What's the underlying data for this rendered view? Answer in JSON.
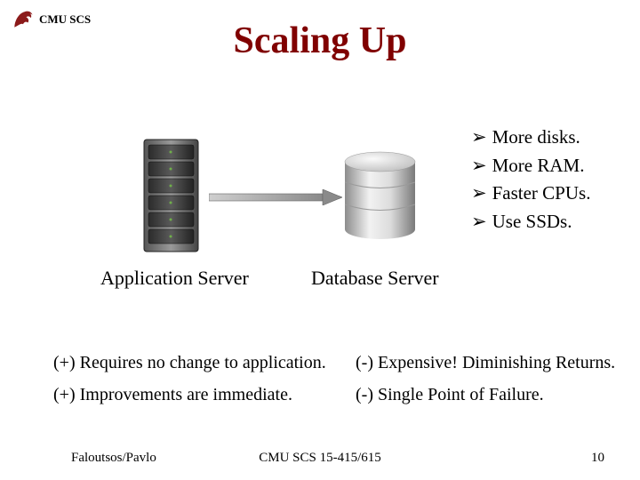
{
  "header": {
    "org": "CMU SCS"
  },
  "title": "Scaling Up",
  "bullets": [
    "More disks.",
    "More RAM.",
    "Faster CPUs.",
    "Use SSDs."
  ],
  "captions": {
    "app": "Application Server",
    "db": "Database Server"
  },
  "pros": [
    "(+)  Requires no change to application.",
    "(+) Improvements are immediate."
  ],
  "cons": [
    "(-)  Expensive! Diminishing Returns.",
    "(-)  Single Point of Failure."
  ],
  "footer": {
    "left": "Faloutsos/Pavlo",
    "center": "CMU SCS 15-415/615",
    "right": "10"
  },
  "colors": {
    "title": "#800000",
    "logo": "#8B1A1A"
  }
}
